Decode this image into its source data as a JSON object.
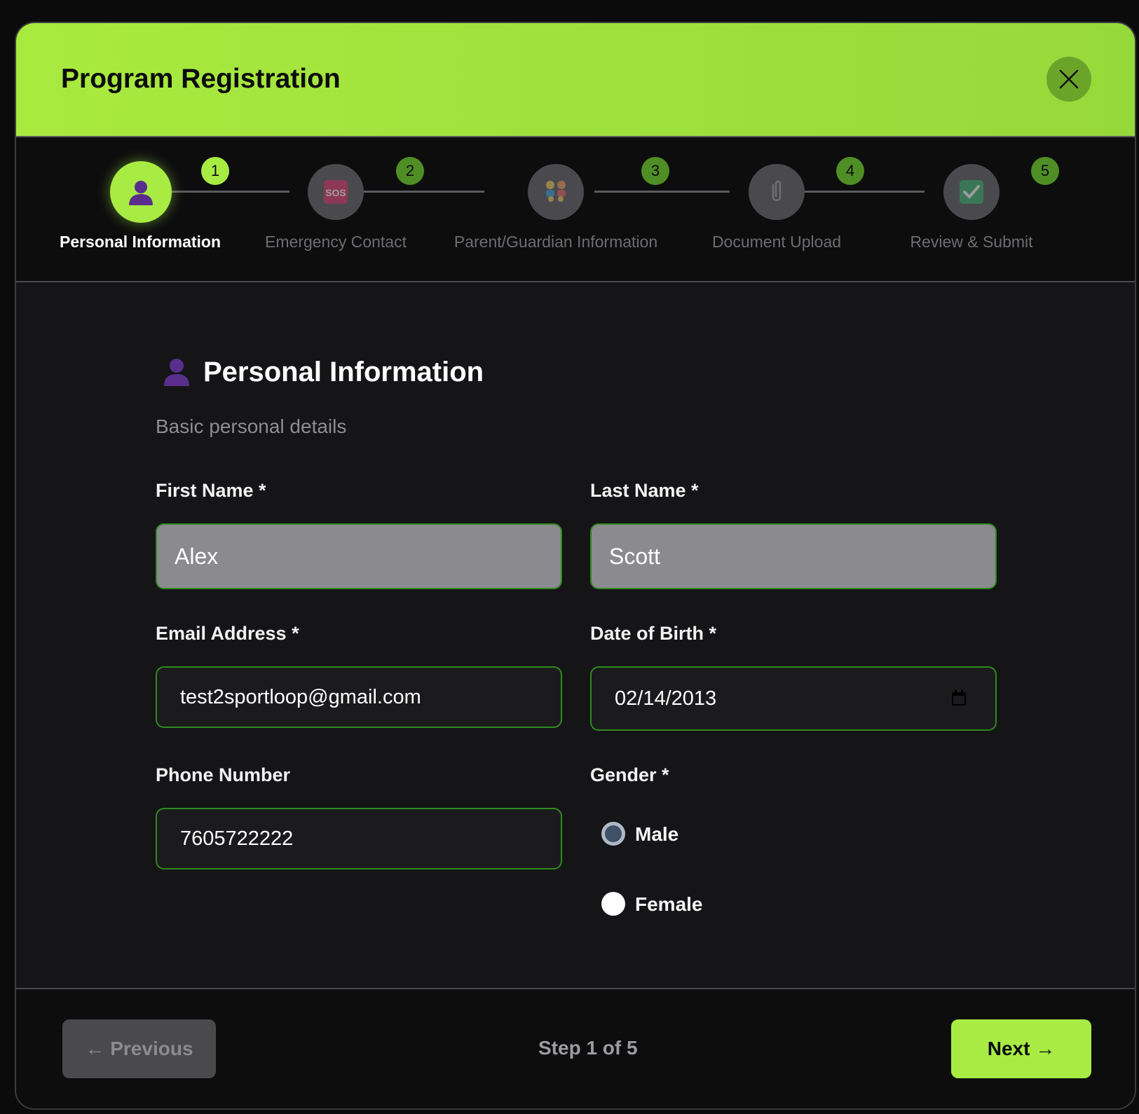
{
  "header": {
    "title": "Program Registration",
    "close_icon": "close-icon"
  },
  "stepper": {
    "steps": [
      {
        "number": "1",
        "label": "Personal Information",
        "icon": "person-icon",
        "active": true
      },
      {
        "number": "2",
        "label": "Emergency Contact",
        "icon": "sos-icon",
        "active": false
      },
      {
        "number": "3",
        "label": "Parent/Guardian Information",
        "icon": "family-icon",
        "active": false
      },
      {
        "number": "4",
        "label": "Document Upload",
        "icon": "paperclip-icon",
        "active": false
      },
      {
        "number": "5",
        "label": "Review & Submit",
        "icon": "checkmark-icon",
        "active": false
      }
    ]
  },
  "section": {
    "title": "Personal Information",
    "subtitle": "Basic personal details",
    "icon": "person-icon"
  },
  "form": {
    "first_name": {
      "label": "First Name *",
      "value": "Alex"
    },
    "last_name": {
      "label": "Last Name *",
      "value": "Scott"
    },
    "email": {
      "label": "Email Address *",
      "value": "test2sportloop@gmail.com"
    },
    "dob": {
      "label": "Date of Birth *",
      "value": "02/14/2013"
    },
    "phone": {
      "label": "Phone Number",
      "value": "7605722222"
    },
    "gender": {
      "label": "Gender *",
      "options": [
        {
          "label": "Male",
          "checked": true
        },
        {
          "label": "Female",
          "checked": false
        }
      ]
    }
  },
  "footer": {
    "previous_label": "← Previous",
    "step_indicator": "Step 1 of 5",
    "next_label": "Next →"
  },
  "colors": {
    "accent": "#a8ec43",
    "field_border": "#2f8a1f",
    "background": "#121214"
  }
}
